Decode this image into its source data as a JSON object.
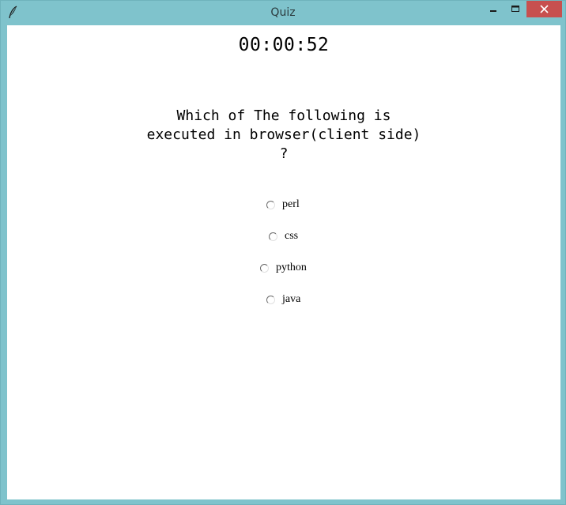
{
  "window": {
    "title": "Quiz",
    "icon": "feather-icon",
    "controls": [
      "minimize-icon",
      "maximize-icon",
      "close-icon"
    ],
    "close_color": "#c7504f",
    "frame_color": "#7fc3cc"
  },
  "quiz": {
    "timer": "00:00:52",
    "question_lines": [
      "Which of The following is",
      "executed in browser(client side)",
      "?"
    ],
    "options": [
      "perl",
      "css",
      "python",
      "java"
    ]
  }
}
